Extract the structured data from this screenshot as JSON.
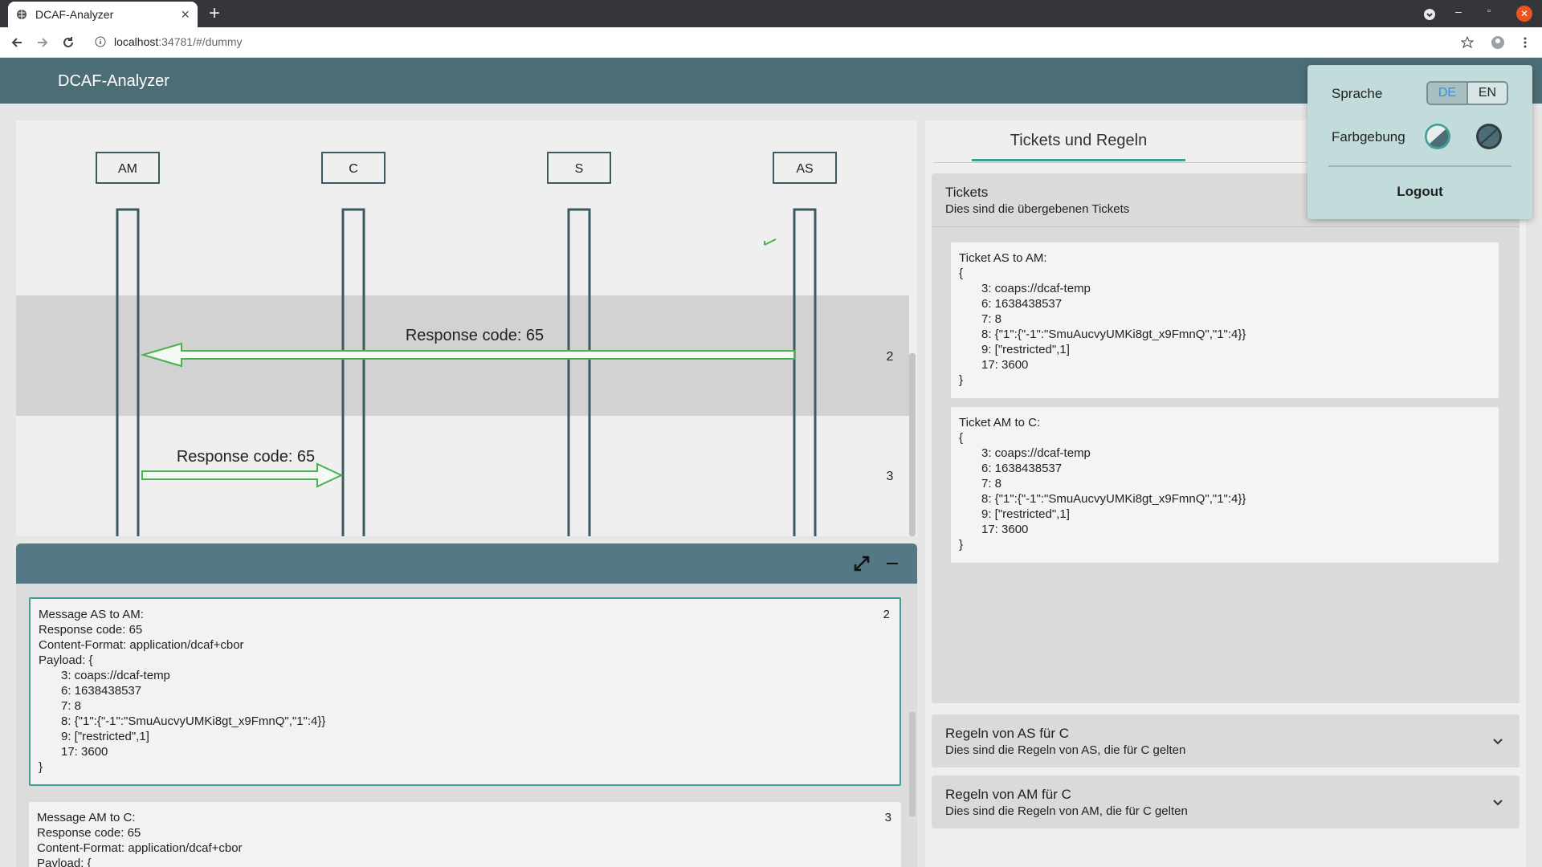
{
  "browser": {
    "tab_title": "DCAF-Analyzer",
    "url_host": "localhost",
    "url_path": ":34781/#/dummy"
  },
  "app": {
    "title": "DCAF-Analyzer"
  },
  "diagram": {
    "participants": [
      "AM",
      "C",
      "S",
      "AS"
    ],
    "messages": [
      {
        "label": "Response code: 65",
        "number": "2"
      },
      {
        "label": "Response code: 65",
        "number": "3"
      }
    ]
  },
  "details": {
    "messages": [
      {
        "number": "2",
        "lines": [
          "Message AS to AM:",
          "Response code: 65",
          "Content-Format: application/dcaf+cbor",
          "Payload: {"
        ],
        "payload": [
          "3: coaps://dcaf-temp",
          "6: 1638438537",
          "7: 8",
          "8: {\"1\":{\"-1\":\"SmuAucvyUMKi8gt_x9FmnQ\",\"1\":4}}",
          "9: [\"restricted\",1]",
          "17: 3600"
        ],
        "close": "}"
      },
      {
        "number": "3",
        "lines": [
          "Message AM to C:",
          "Response code: 65",
          "Content-Format: application/dcaf+cbor",
          "Payload: {"
        ]
      }
    ]
  },
  "right_panel": {
    "tab_label": "Tickets und Regeln",
    "tickets_section": {
      "title": "Tickets",
      "subtitle": "Dies sind die übergebenen Tickets",
      "tickets": [
        {
          "heading": "Ticket AS to AM:",
          "open": "{",
          "lines": [
            "3: coaps://dcaf-temp",
            "6: 1638438537",
            "7: 8",
            "8: {\"1\":{\"-1\":\"SmuAucvyUMKi8gt_x9FmnQ\",\"1\":4}}",
            "9: [\"restricted\",1]",
            "17: 3600"
          ],
          "close": "}"
        },
        {
          "heading": "Ticket AM to C:",
          "open": "{",
          "lines": [
            "3: coaps://dcaf-temp",
            "6: 1638438537",
            "7: 8",
            "8: {\"1\":{\"-1\":\"SmuAucvyUMKi8gt_x9FmnQ\",\"1\":4}}",
            "9: [\"restricted\",1]",
            "17: 3600"
          ],
          "close": "}"
        }
      ]
    },
    "rules_as": {
      "title": "Regeln von AS für C",
      "subtitle": "Dies sind die Regeln von AS, die für C gelten"
    },
    "rules_am": {
      "title": "Regeln von AM für C",
      "subtitle": "Dies sind die Regeln von AM, die für C gelten"
    }
  },
  "settings": {
    "language_label": "Sprache",
    "lang_de": "DE",
    "lang_en": "EN",
    "color_label": "Farbgebung",
    "logout": "Logout"
  },
  "colors": {
    "header": "#4d6d76",
    "accent": "#3e9e94",
    "arrow": "#4caf50",
    "popup": "#c2dbdb"
  }
}
